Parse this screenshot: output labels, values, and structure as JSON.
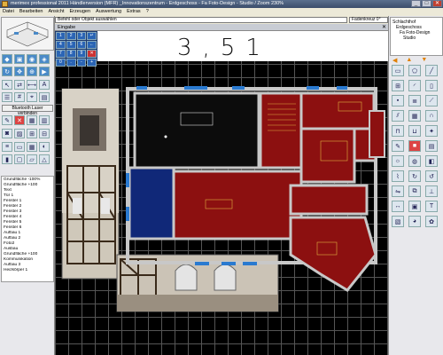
{
  "titlebar": {
    "title": "merimex professional 2011 Händlerversion (MFR) _Innovationszentrum - Erdgeschoss - Fa Foto-Design - Studio / Zoom 230%"
  },
  "window_controls": {
    "minimize": "_",
    "maximize": "□",
    "close": "✕"
  },
  "menu": [
    "Datei",
    "Bearbeiten",
    "Ansicht",
    "Erzeugen",
    "Auswertung",
    "Extras",
    "?"
  ],
  "command": {
    "prompt": "Befehl oder Objekt auswählen",
    "fadenkreuz": "Fadenkreuz 0°"
  },
  "eingabe": {
    "label": "Eingabe",
    "close": "✕"
  },
  "keypad": [
    "1",
    "2",
    "3",
    "↵",
    "4",
    "5",
    "6",
    "←",
    "7",
    "8",
    "9",
    "✕",
    "0",
    ".",
    "-",
    "+"
  ],
  "handwriting": "3,51",
  "left": {
    "bluetooth_button": "Bluetooth Laser verbinden",
    "layers": [
      "Grundfläche -100%",
      "Grundfläche +100",
      "Text",
      "Tür 1",
      "Fenster 1",
      "Fenster 2",
      "Fenster 3",
      "Fenster 4",
      "Fenster 5",
      "Fenster 6",
      "Aufbau 1",
      "Aufbau 2",
      "Foto2",
      "Ausbau",
      "Grundfläche +100",
      "Kommunikation",
      "Aufbau 3",
      "Heizkörper 1"
    ]
  },
  "right": {
    "tree": [
      "Schlachthof",
      "Erdgeschoss",
      "Fa Foto-Design",
      "Studio"
    ],
    "nav": [
      "◀",
      "▲",
      "▼"
    ]
  },
  "colors": {
    "room_red": "#8c1010",
    "room_blue": "#102878",
    "room_black": "#0c0c0c",
    "wall": "#c8c8c8",
    "window": "#2a7ad0"
  }
}
